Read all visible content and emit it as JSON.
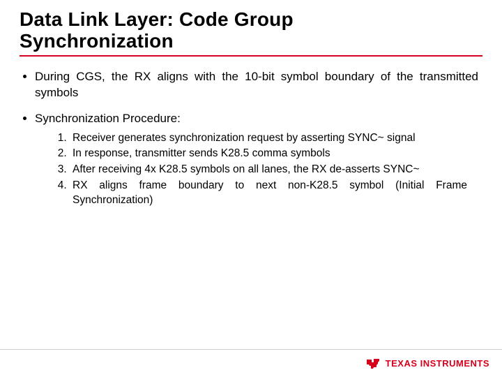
{
  "title_line1": "Data Link Layer: Code Group",
  "title_line2": "Synchronization",
  "bullets": {
    "b1": "During CGS, the RX aligns with the 10-bit symbol boundary of the transmitted symbols",
    "b2": "Synchronization Procedure:"
  },
  "steps": {
    "s1": "Receiver generates synchronization request by asserting SYNC~ signal",
    "s2": "In response, transmitter sends K28.5 comma symbols",
    "s3": "After receiving 4x K28.5 symbols on all lanes, the RX de-asserts SYNC~",
    "s4": "RX aligns frame boundary to next non-K28.5 symbol (Initial Frame Synchronization)"
  },
  "footer": {
    "brand": "TEXAS INSTRUMENTS"
  }
}
